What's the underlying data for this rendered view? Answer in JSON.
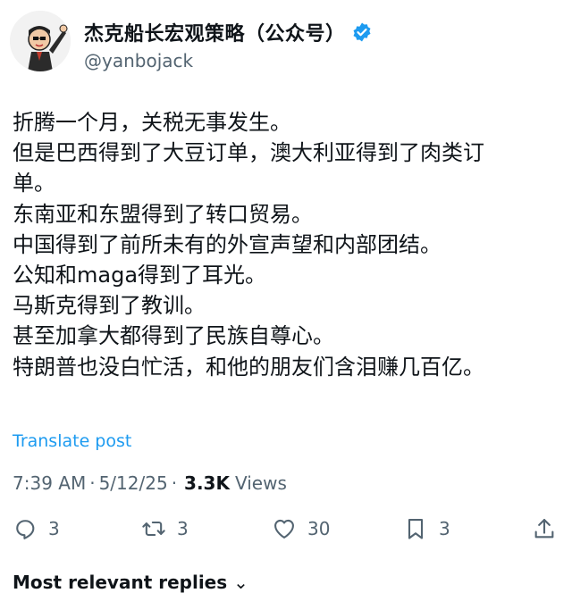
{
  "author": {
    "display_name": "杰克船长宏观策略（公众号）",
    "handle": "@yanbojack",
    "verified_icon": "verified-badge-icon"
  },
  "post": {
    "lines": [
      "折腾一个月，关税无事发生。",
      "但是巴西得到了大豆订单，澳大利亚得到了肉类订",
      "单。",
      "东南亚和东盟得到了转口贸易。",
      "中国得到了前所未有的外宣声望和内部团结。",
      "公知和maga得到了耳光。",
      "马斯克得到了教训。",
      "甚至加拿大都得到了民族自尊心。",
      "特朗普也没白忙活，和他的朋友们含泪赚几百亿。"
    ],
    "translate_label": "Translate post"
  },
  "meta": {
    "time": "7:39 AM",
    "separator": "·",
    "date": "5/12/25",
    "views_count": "3.3K",
    "views_label": "Views"
  },
  "actions": {
    "reply": {
      "icon": "reply-icon",
      "count": "3"
    },
    "repost": {
      "icon": "repost-icon",
      "count": "3"
    },
    "like": {
      "icon": "heart-icon",
      "count": "30"
    },
    "bookmark": {
      "icon": "bookmark-icon",
      "count": "3"
    },
    "share": {
      "icon": "share-icon"
    }
  },
  "replies": {
    "sort_label": "Most relevant replies"
  },
  "colors": {
    "accent": "#1d9bf0",
    "text": "#0f1419",
    "muted": "#536471"
  }
}
